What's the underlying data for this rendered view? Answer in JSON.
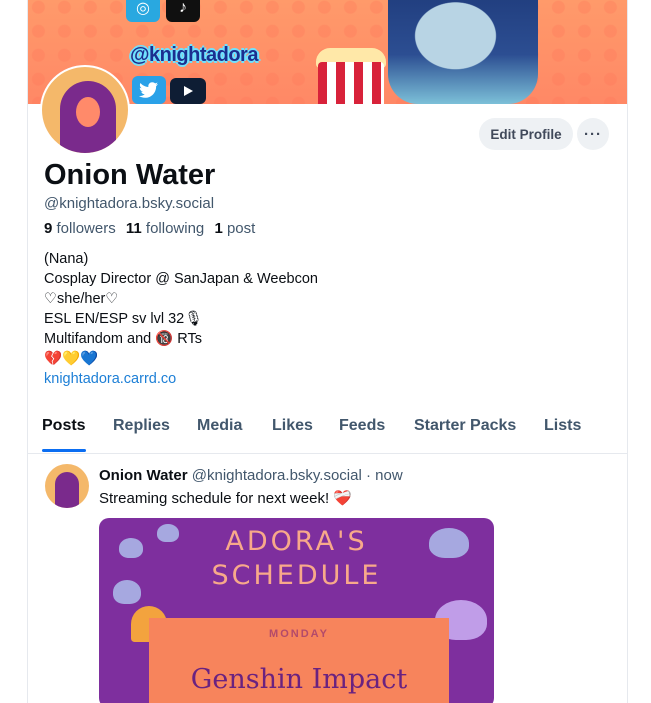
{
  "banner": {
    "handle_text": "@knightadora",
    "icons": [
      "instagram-icon",
      "tiktok-icon",
      "twitter-icon",
      "youtube-icon"
    ]
  },
  "profile": {
    "display_name": "Onion Water",
    "handle": "@knightadora.bsky.social",
    "edit_button": "Edit Profile",
    "more_button": "···",
    "followers_count": "9",
    "followers_label": "followers",
    "following_count": "11",
    "following_label": "following",
    "posts_count": "1",
    "posts_label": "post",
    "bio": [
      "(Nana)",
      "Cosplay Director @ SanJapan & Weebcon",
      "♡she/her♡",
      "ESL EN/ESP sᴠ lvl 32🎙",
      "Multifandom and 🔞 RTs",
      "💔💛💙"
    ],
    "link": "knightadora.carrd.co"
  },
  "tabs": [
    "Posts",
    "Replies",
    "Media",
    "Likes",
    "Feeds",
    "Starter Packs",
    "Lists"
  ],
  "post": {
    "author": "Onion Water",
    "handle": "@knightadora.bsky.social",
    "separator": "·",
    "time": "now",
    "text": "Streaming schedule for next week!",
    "emoji": "❤️‍🩹",
    "image": {
      "title_line1": "ADORA'S",
      "title_line2": "SCHEDULE",
      "day": "MONDAY",
      "game": "Genshin Impact"
    }
  },
  "colors": {
    "accent": "#0b6ef2",
    "link": "#1d7fd6",
    "banner": "#ff8866",
    "schedule_bg": "#7e2f9e"
  }
}
